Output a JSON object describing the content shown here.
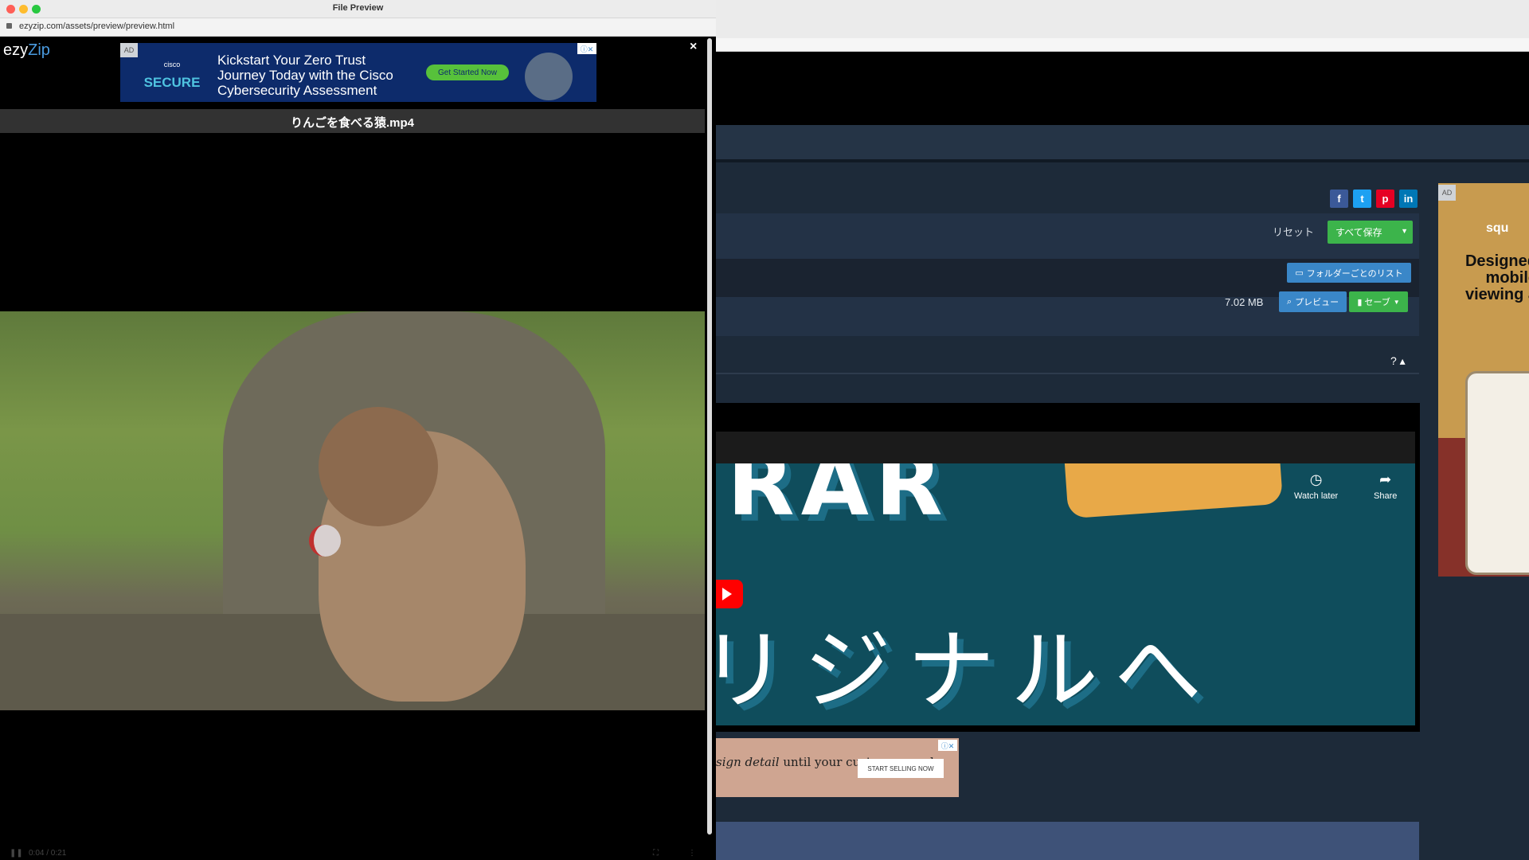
{
  "window": {
    "title": "File Preview",
    "url": "ezyzip.com/assets/preview/preview.html"
  },
  "preview": {
    "logo_main": "ezy",
    "logo_accent": "Zip",
    "close_symbol": "×",
    "filename": "りんごを食べる猿.mp4",
    "time_display": "0:04 / 0:21"
  },
  "ad_top": {
    "badge": "AD",
    "brand_small": "cisco",
    "brand_large": "SECURE",
    "headline": "Kickstart Your Zero Trust Journey Today with the Cisco Cybersecurity Assessment",
    "cta": "Get Started Now",
    "close": "ⓘ✕"
  },
  "toolbar": {
    "social": [
      {
        "name": "facebook",
        "glyph": "f",
        "color": "#3b5998"
      },
      {
        "name": "twitter",
        "glyph": "t",
        "color": "#1da1f2"
      },
      {
        "name": "pinterest",
        "glyph": "p",
        "color": "#e60023"
      },
      {
        "name": "linkedin",
        "glyph": "in",
        "color": "#0077b5"
      }
    ],
    "reset_label": "リセット",
    "save_all_label": "すべて保存",
    "folder_list_label": "フォルダーごとのリスト",
    "file_size": "7.02 MB",
    "preview_label": "プレビュー",
    "save_label": "セーブ",
    "help_toggle": "? ▴"
  },
  "embed": {
    "title_fragment": "RAR",
    "subtitle_fragment": "リジナルへ",
    "watch_later": "Watch later",
    "share": "Share"
  },
  "ad_bottom": {
    "text_italic": "sign detail",
    "text_rest": " until your customer-ready.",
    "cta": "START SELLING NOW",
    "close": "ⓘ✕"
  },
  "ad_right": {
    "badge": "AD",
    "logo": "squ",
    "headline": "Designed mobile viewing a"
  }
}
